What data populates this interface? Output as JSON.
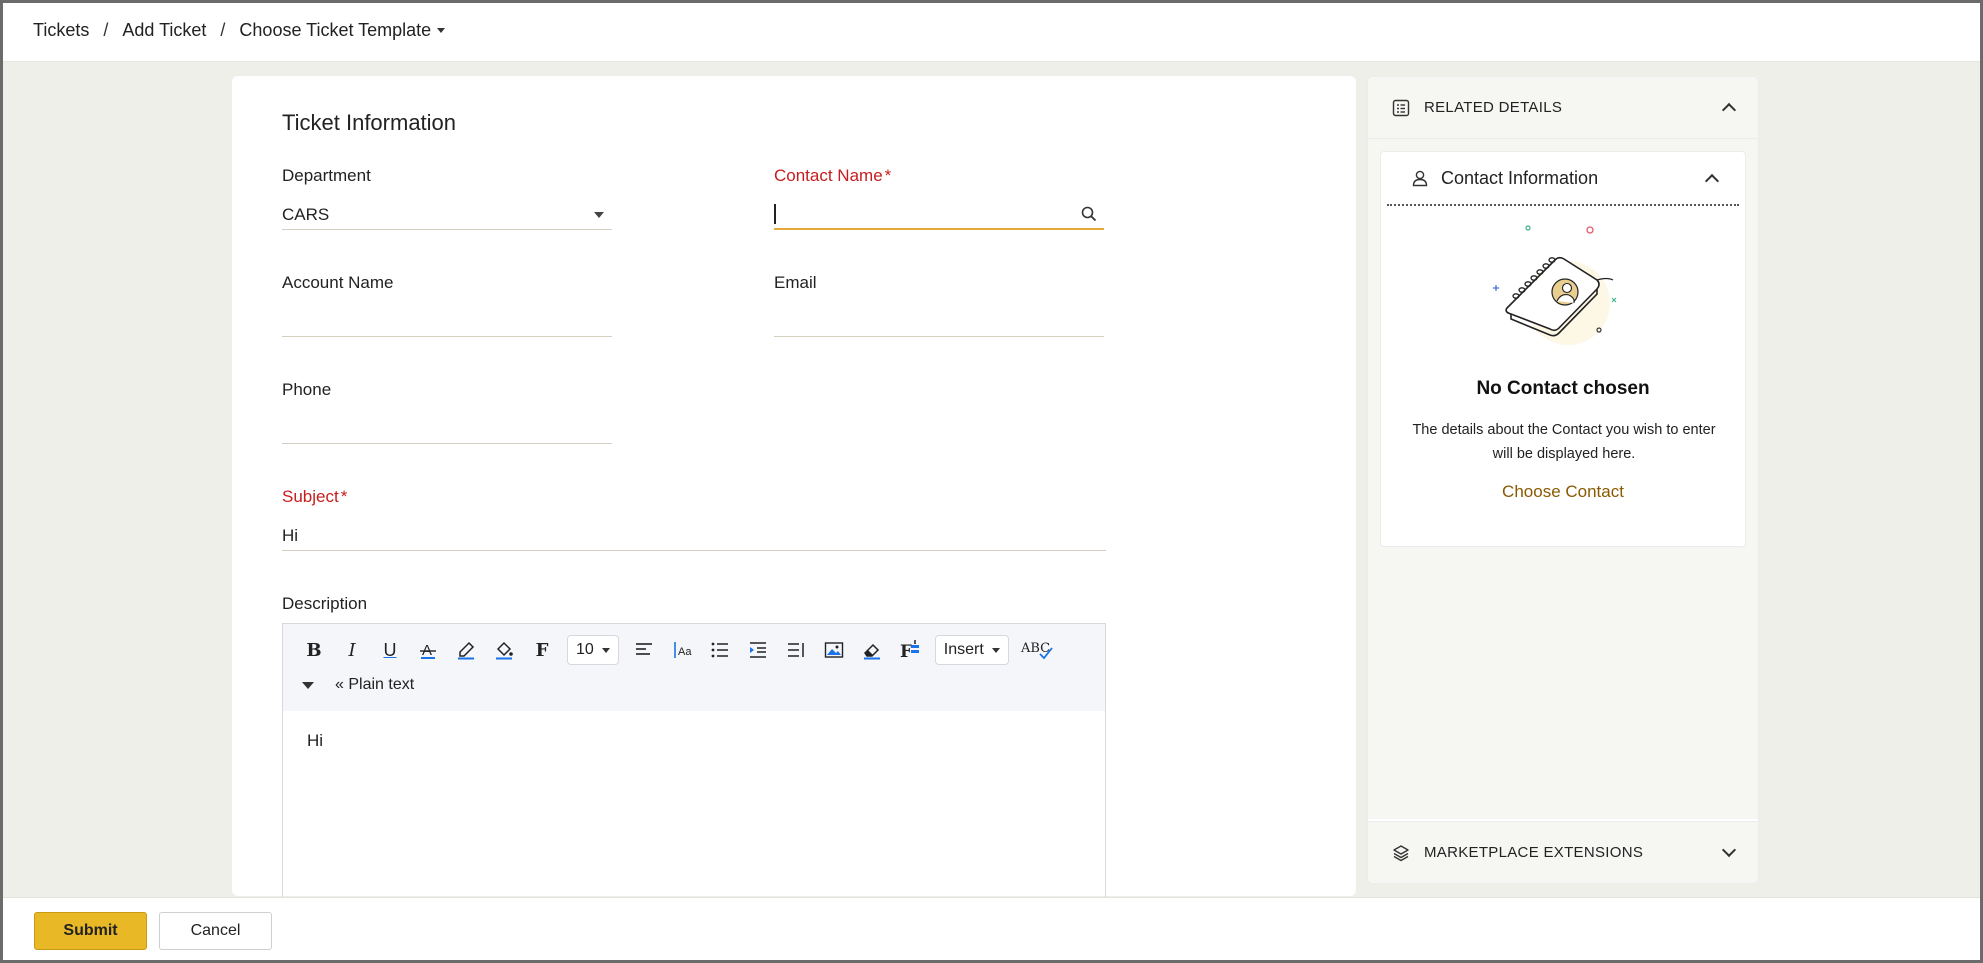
{
  "breadcrumb": {
    "items": [
      "Tickets",
      "Add Ticket"
    ],
    "template_dropdown": "Choose Ticket Template",
    "separator": "/"
  },
  "form": {
    "title": "Ticket Information",
    "department": {
      "label": "Department",
      "value": "CARS"
    },
    "contact_name": {
      "label": "Contact Name",
      "required_mark": "*",
      "value": ""
    },
    "account_name": {
      "label": "Account Name",
      "value": ""
    },
    "email": {
      "label": "Email",
      "value": ""
    },
    "phone": {
      "label": "Phone",
      "value": ""
    },
    "subject": {
      "label": "Subject",
      "required_mark": "*",
      "value": "Hi"
    },
    "description": {
      "label": "Description",
      "font_size": "10",
      "insert_label": "Insert",
      "plain_text_label": "« Plain text",
      "content": "Hi"
    }
  },
  "related_panel": {
    "header": "RELATED DETAILS",
    "contact_info": {
      "title": "Contact Information",
      "empty_title": "No Contact chosen",
      "empty_desc": "The details about the Contact you wish to enter will be displayed here.",
      "choose_link": "Choose Contact"
    },
    "marketplace": "MARKETPLACE EXTENSIONS"
  },
  "actions": {
    "submit": "Submit",
    "cancel": "Cancel"
  },
  "colors": {
    "accent": "#e9b826",
    "required": "#c61d1d",
    "focus_underline": "#e8a93b",
    "link": "#8a5a00",
    "background": "#efefea"
  }
}
